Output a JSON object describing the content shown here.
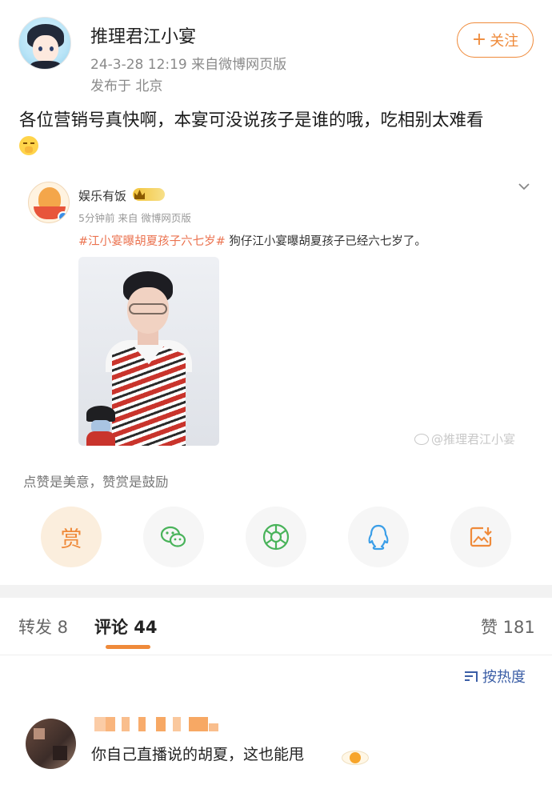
{
  "post": {
    "author": "推理君江小宴",
    "meta": "24-3-28 12:19  来自微博网页版",
    "location": "发布于 北京",
    "follow_label": "关注",
    "text": "各位营销号真快啊，本宴可没说孩子是谁的哦，吃相别太难看"
  },
  "repost": {
    "author": "娱乐有饭",
    "meta": "5分钟前  来自 微博网页版",
    "hashtag": "#江小宴曝胡夏孩子六七岁#",
    "body": " 狗仔江小宴曝胡夏孩子已经六七岁了。",
    "watermark": "@推理君江小宴"
  },
  "reward": {
    "text": "点赞是美意，赞赏是鼓励",
    "reward_button": "赏"
  },
  "share_icons": [
    "reward-icon",
    "wechat-icon",
    "moments-icon",
    "qq-icon",
    "save-image-icon"
  ],
  "tabs": {
    "repost": "转发 8",
    "comment": "评论 44",
    "like": "赞 181"
  },
  "sort_label": "按热度",
  "comment": {
    "text": "你自己直播说的胡夏，这也能甩"
  },
  "colors": {
    "accent": "#ef8a3a",
    "link_blue": "#3b5ea6",
    "hashtag": "#eb7350"
  }
}
